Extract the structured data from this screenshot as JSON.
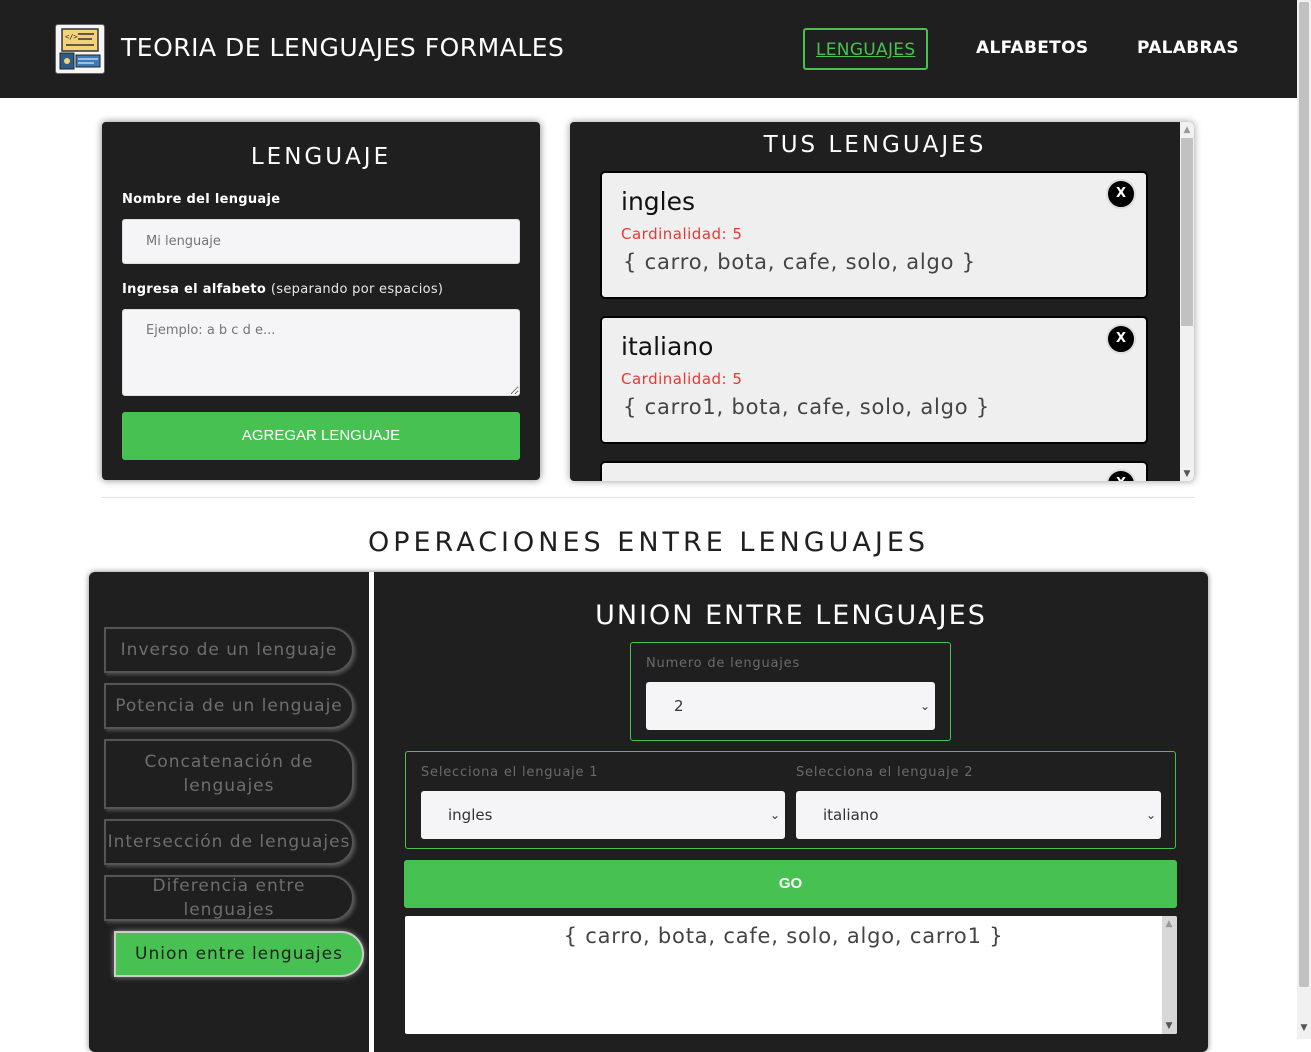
{
  "header": {
    "title": "TEORIA DE LENGUAJES FORMALES",
    "nav": [
      {
        "label": "LENGUAJES",
        "active": true
      },
      {
        "label": "ALFABETOS",
        "active": false
      },
      {
        "label": "PALABRAS",
        "active": false
      }
    ]
  },
  "form": {
    "title": "LENGUAJE",
    "name_label": "Nombre del lenguaje",
    "name_placeholder": "Mi lenguaje",
    "alphabet_label": "Ingresa el alfabeto",
    "alphabet_hint": "(separando por espacios)",
    "alphabet_placeholder": "Ejemplo: a b c d e...",
    "submit_label": "AGREGAR LENGUAJE"
  },
  "languages": {
    "title": "TUS LENGUAJES",
    "cardinality_prefix": "Cardinalidad:",
    "close_label": "X",
    "items": [
      {
        "name": "ingles",
        "cardinality": "Cardinalidad: 5",
        "words": "{ carro, bota, cafe, solo, algo }"
      },
      {
        "name": "italiano",
        "cardinality": "Cardinalidad: 5",
        "words": "{ carro1, bota, cafe, solo, algo }"
      }
    ]
  },
  "operations": {
    "title": "OPERACIONES ENTRE LENGUAJES",
    "menu": [
      {
        "label": "Inverso de un lenguaje",
        "active": false
      },
      {
        "label": "Potencia de un lenguaje",
        "active": false
      },
      {
        "label": "Concatenación de lenguajes",
        "active": false
      },
      {
        "label": "Intersección de lenguajes",
        "active": false
      },
      {
        "label": "Diferencia entre lenguajes",
        "active": false
      },
      {
        "label": "Union entre lenguajes",
        "active": true
      }
    ],
    "panel": {
      "title": "UNION ENTRE LENGUAJES",
      "count_label": "Numero de lenguajes",
      "count_value": "2",
      "select1_label": "Selecciona el lenguaje 1",
      "select1_value": "ingles",
      "select2_label": "Selecciona el lenguaje 2",
      "select2_value": "italiano",
      "go_label": "GO",
      "result": "{ carro, bota, cafe, solo, algo, carro1 }"
    }
  },
  "colors": {
    "accent": "#48c153",
    "dark": "#1f1f1f",
    "cardinality": "#e53935"
  },
  "icons": [
    "app-logo-icon",
    "close-icon",
    "chevron-down-icon",
    "scroll-up-icon",
    "scroll-down-icon"
  ]
}
